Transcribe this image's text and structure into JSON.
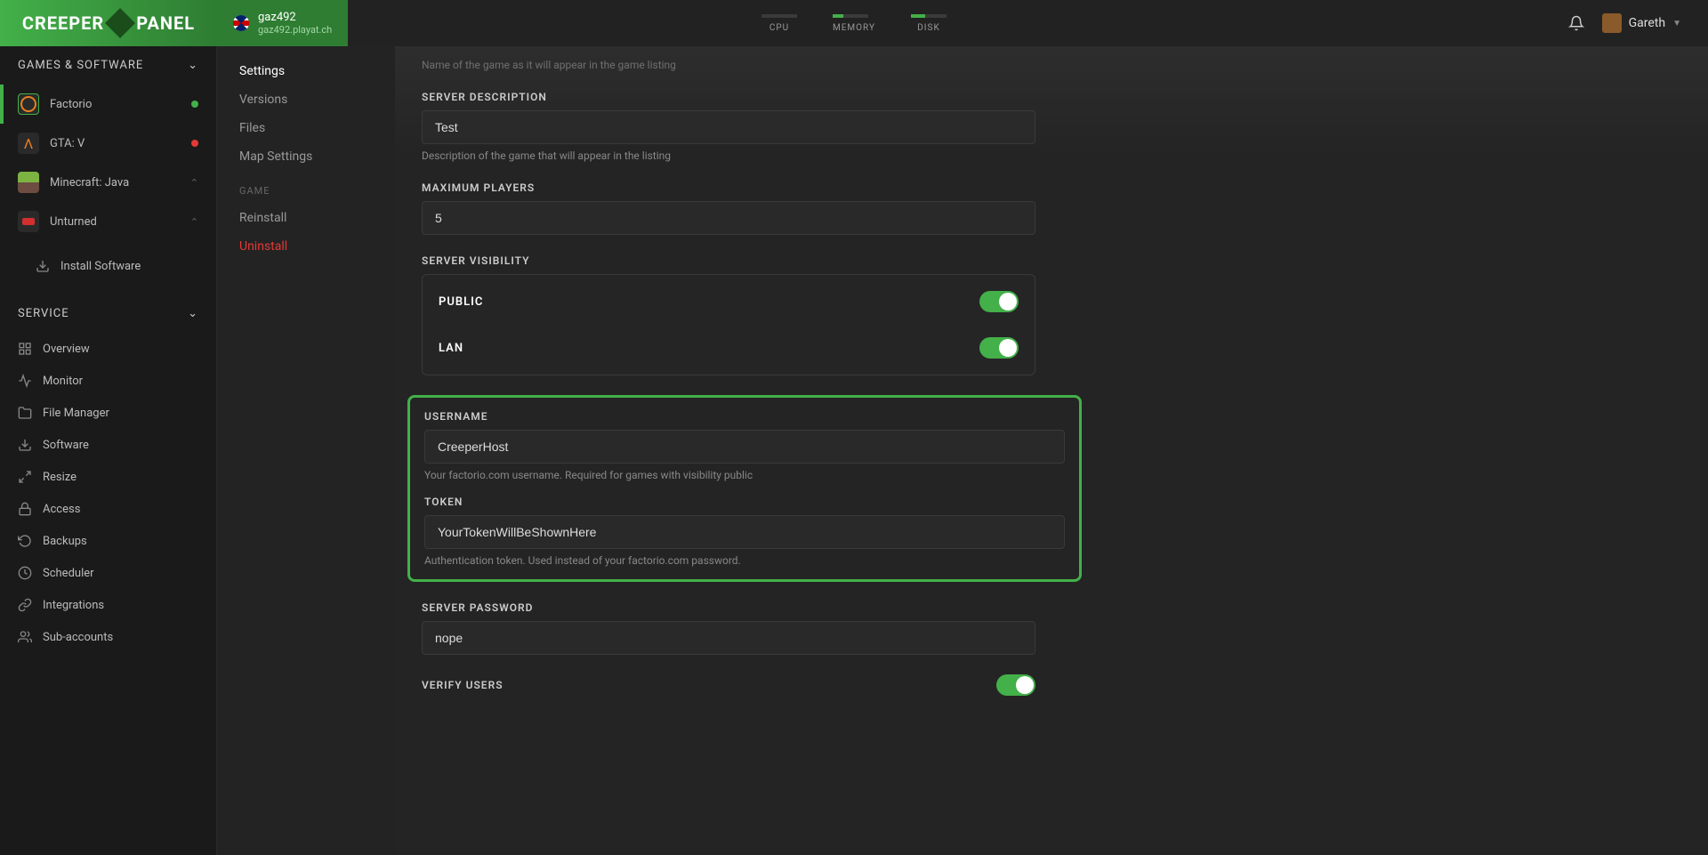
{
  "header": {
    "logo": "CREEPER PANEL",
    "server": {
      "name": "gaz492",
      "host": "gaz492.playat.ch"
    },
    "usage": {
      "cpu": "CPU",
      "memory": "MEMORY",
      "disk": "DISK"
    },
    "user": "Gareth"
  },
  "sidebar": {
    "games_header": "GAMES & SOFTWARE",
    "games": [
      {
        "label": "Factorio",
        "status": "green"
      },
      {
        "label": "GTA: V",
        "status": "red"
      },
      {
        "label": "Minecraft: Java"
      },
      {
        "label": "Unturned"
      }
    ],
    "install_software": "Install Software",
    "service_header": "SERVICE",
    "service_items": [
      "Overview",
      "Monitor",
      "File Manager",
      "Software",
      "Resize",
      "Access",
      "Backups",
      "Scheduler",
      "Integrations",
      "Sub-accounts"
    ]
  },
  "subnav": {
    "settings": "Settings",
    "versions": "Versions",
    "files": "Files",
    "map_settings": "Map Settings",
    "game_header": "GAME",
    "reinstall": "Reinstall",
    "uninstall": "Uninstall"
  },
  "form": {
    "name_hint": "Name of the game as it will appear in the game listing",
    "description": {
      "label": "SERVER DESCRIPTION",
      "value": "Test",
      "hint": "Description of the game that will appear in the listing"
    },
    "max_players": {
      "label": "MAXIMUM PLAYERS",
      "value": "5"
    },
    "visibility": {
      "label": "SERVER VISIBILITY",
      "public": "PUBLIC",
      "lan": "LAN"
    },
    "username": {
      "label": "USERNAME",
      "value": "CreeperHost",
      "hint": "Your factorio.com username. Required for games with visibility public"
    },
    "token": {
      "label": "TOKEN",
      "value": "YourTokenWillBeShownHere",
      "hint": "Authentication token. Used instead of your factorio.com password."
    },
    "password": {
      "label": "SERVER PASSWORD",
      "value": "nope"
    },
    "verify_users": {
      "label": "VERIFY USERS"
    }
  }
}
